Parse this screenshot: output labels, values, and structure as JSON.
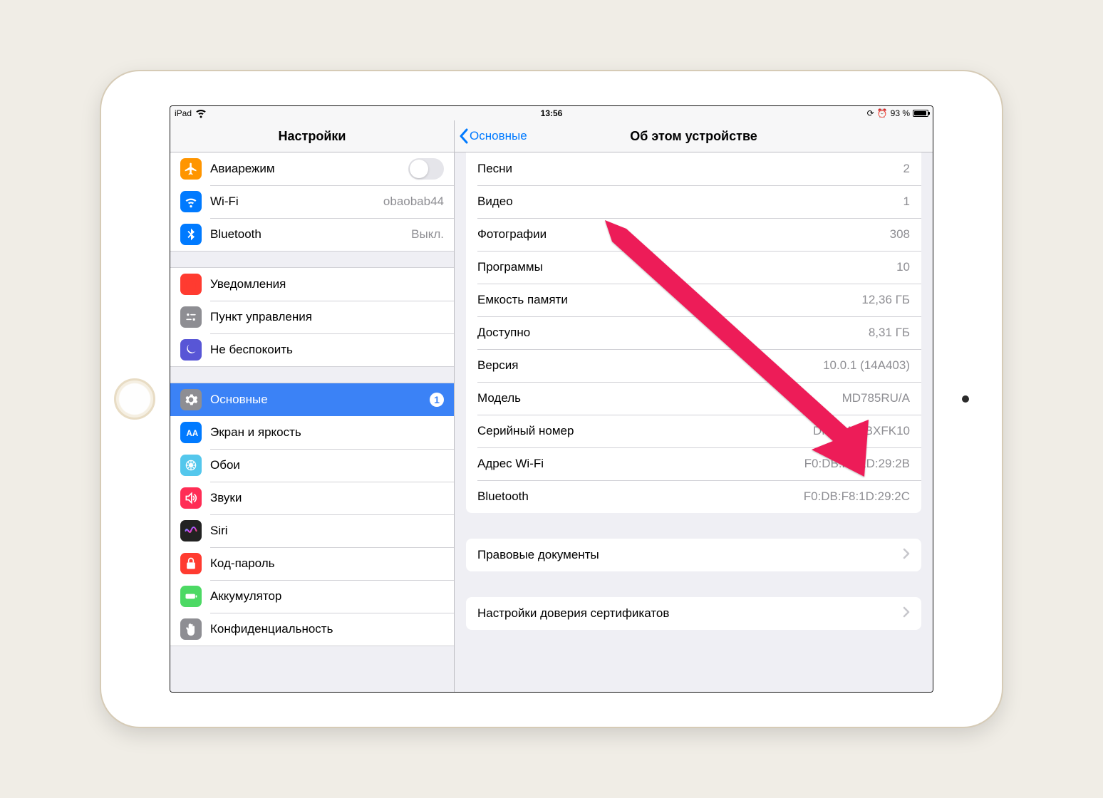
{
  "statusbar": {
    "device": "iPad",
    "time": "13:56",
    "battery_pct": "93 %"
  },
  "sidebar": {
    "title": "Настройки",
    "groups": [
      {
        "rows": [
          {
            "id": "airplane",
            "label": "Авиарежим",
            "icon": "airplane",
            "color": "#ff9500",
            "control": "toggle"
          },
          {
            "id": "wifi",
            "label": "Wi-Fi",
            "icon": "wifi",
            "color": "#007aff",
            "value": "obaobab44"
          },
          {
            "id": "bluetooth",
            "label": "Bluetooth",
            "icon": "bluetooth",
            "color": "#007aff",
            "value": "Выкл."
          }
        ]
      },
      {
        "rows": [
          {
            "id": "notifications",
            "label": "Уведомления",
            "icon": "notifications",
            "color": "#ff3b30"
          },
          {
            "id": "control-center",
            "label": "Пункт управления",
            "icon": "control",
            "color": "#8e8e93"
          },
          {
            "id": "dnd",
            "label": "Не беспокоить",
            "icon": "moon",
            "color": "#5856d6"
          }
        ]
      },
      {
        "rows": [
          {
            "id": "general",
            "label": "Основные",
            "icon": "gear",
            "color": "#8e8e93",
            "selected": true,
            "badge": "1"
          },
          {
            "id": "display",
            "label": "Экран и яркость",
            "icon": "display",
            "color": "#007aff"
          },
          {
            "id": "wallpaper",
            "label": "Обои",
            "icon": "wallpaper",
            "color": "#54c7ec"
          },
          {
            "id": "sounds",
            "label": "Звуки",
            "icon": "speaker",
            "color": "#ff2d55"
          },
          {
            "id": "siri",
            "label": "Siri",
            "icon": "siri",
            "color": "#222"
          },
          {
            "id": "passcode",
            "label": "Код-пароль",
            "icon": "lock",
            "color": "#ff3b30"
          },
          {
            "id": "battery",
            "label": "Аккумулятор",
            "icon": "battery",
            "color": "#4cd964"
          },
          {
            "id": "privacy",
            "label": "Конфиденциальность",
            "icon": "hand",
            "color": "#8e8e93"
          }
        ]
      }
    ]
  },
  "detail": {
    "back_label": "Основные",
    "title": "Об этом устройстве",
    "info": [
      {
        "k": "Песни",
        "v": "2"
      },
      {
        "k": "Видео",
        "v": "1"
      },
      {
        "k": "Фотографии",
        "v": "308"
      },
      {
        "k": "Программы",
        "v": "10"
      },
      {
        "k": "Емкость памяти",
        "v": "12,36 ГБ"
      },
      {
        "k": "Доступно",
        "v": "8,31 ГБ"
      },
      {
        "k": "Версия",
        "v": "10.0.1 (14A403)"
      },
      {
        "k": "Модель",
        "v": "MD785RU/A"
      },
      {
        "k": "Серийный номер",
        "v": "DMQM26BXFK10"
      },
      {
        "k": "Адрес Wi-Fi",
        "v": "F0:DB:F8:1D:29:2B"
      },
      {
        "k": "Bluetooth",
        "v": "F0:DB:F8:1D:29:2C"
      }
    ],
    "links": [
      {
        "label": "Правовые документы"
      },
      {
        "label": "Настройки доверия сертификатов"
      }
    ]
  }
}
